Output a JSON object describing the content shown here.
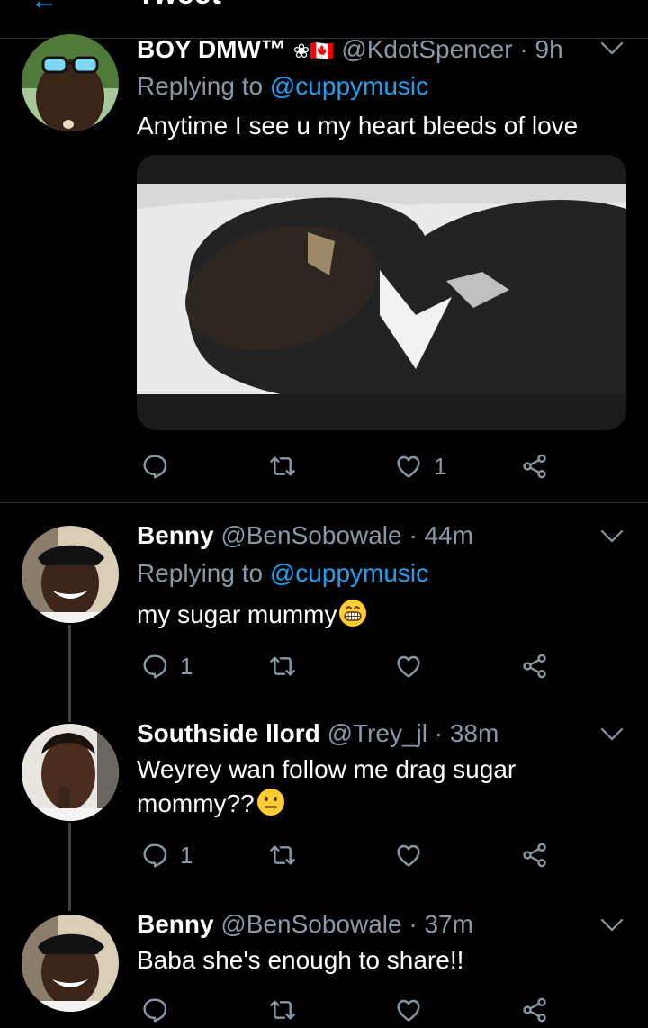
{
  "topbar": {
    "title": "Tweet",
    "back_icon": "arrow-left-icon"
  },
  "colors": {
    "link": "#1da1f2",
    "muted": "#8899a6",
    "background": "#000000"
  },
  "tweets": [
    {
      "name": "BOY DMW™",
      "name_badges": "❀🇨🇦",
      "handle": "@KdotSpencer",
      "time": "· 9h",
      "replying_prefix": "Replying to",
      "replying_to": "@cuppymusic",
      "text": "Anytime I see u my heart bleeds of love",
      "reply_count": "",
      "retweet_count": "",
      "like_count": "1",
      "has_media": true
    },
    {
      "name": "Benny",
      "handle": "@BenSobowale",
      "time": "· 44m",
      "replying_prefix": "Replying to",
      "replying_to": "@cuppymusic",
      "text": "my sugar mummy",
      "emoji": "grinning-face",
      "reply_count": "1",
      "retweet_count": "",
      "like_count": ""
    },
    {
      "name": "Southside llord",
      "handle": "@Trey_jl",
      "time": "· 38m",
      "text_line1": "Weyrey wan follow me drag sugar",
      "text_line2": "mommy??",
      "emoji": "neutral-face",
      "reply_count": "1",
      "retweet_count": "",
      "like_count": ""
    },
    {
      "name": "Benny",
      "handle": "@BenSobowale",
      "time": "· 37m",
      "text": "Baba she's enough to share!!",
      "reply_count": "",
      "retweet_count": "",
      "like_count": ""
    }
  ]
}
